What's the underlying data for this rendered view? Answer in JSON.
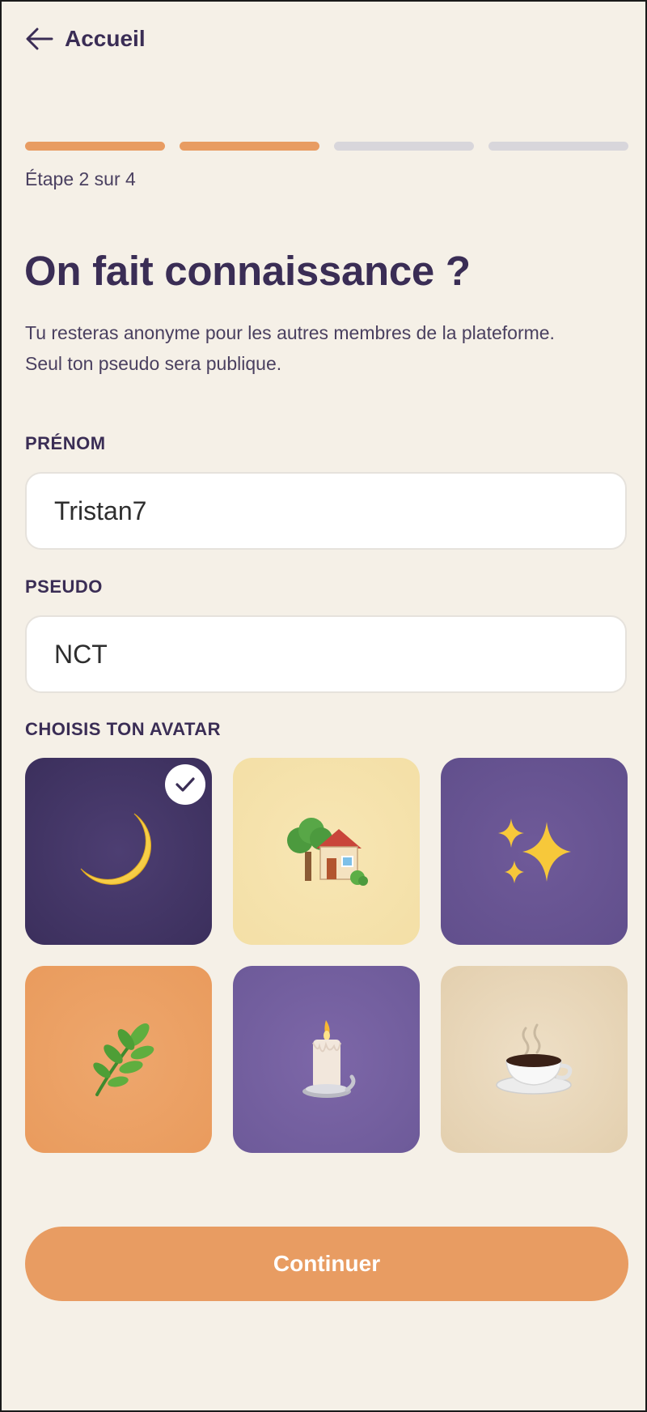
{
  "nav": {
    "back_label": "Accueil",
    "back_icon": "arrow-left-icon"
  },
  "progress": {
    "current_step": 2,
    "total_steps": 4,
    "label": "Étape 2 sur 4"
  },
  "header": {
    "title": "On fait connaissance ?",
    "subtitle": "Tu resteras anonyme pour les autres membres de la plateforme. Seul ton pseudo sera publique."
  },
  "form": {
    "first_name": {
      "label": "PRÉNOM",
      "value": "Tristan7"
    },
    "pseudo": {
      "label": "PSEUDO",
      "value": "NCT"
    },
    "avatar": {
      "label": "CHOISIS TON AVATAR",
      "selected_index": 0,
      "options": [
        {
          "icon": "crescent-moon-icon",
          "background": "#3d305e"
        },
        {
          "icon": "house-with-tree-icon",
          "background": "#f5e2aa"
        },
        {
          "icon": "sparkles-icon",
          "background": "#64518e"
        },
        {
          "icon": "herb-icon",
          "background": "#eba063"
        },
        {
          "icon": "candle-icon",
          "background": "#735f9f"
        },
        {
          "icon": "hot-coffee-icon",
          "background": "#e6d4b5"
        }
      ]
    }
  },
  "actions": {
    "continue_label": "Continuer"
  },
  "colors": {
    "background": "#f5f0e7",
    "accent": "#e89c62",
    "text_primary": "#3a2d55",
    "progress_inactive": "#d8d6db"
  }
}
